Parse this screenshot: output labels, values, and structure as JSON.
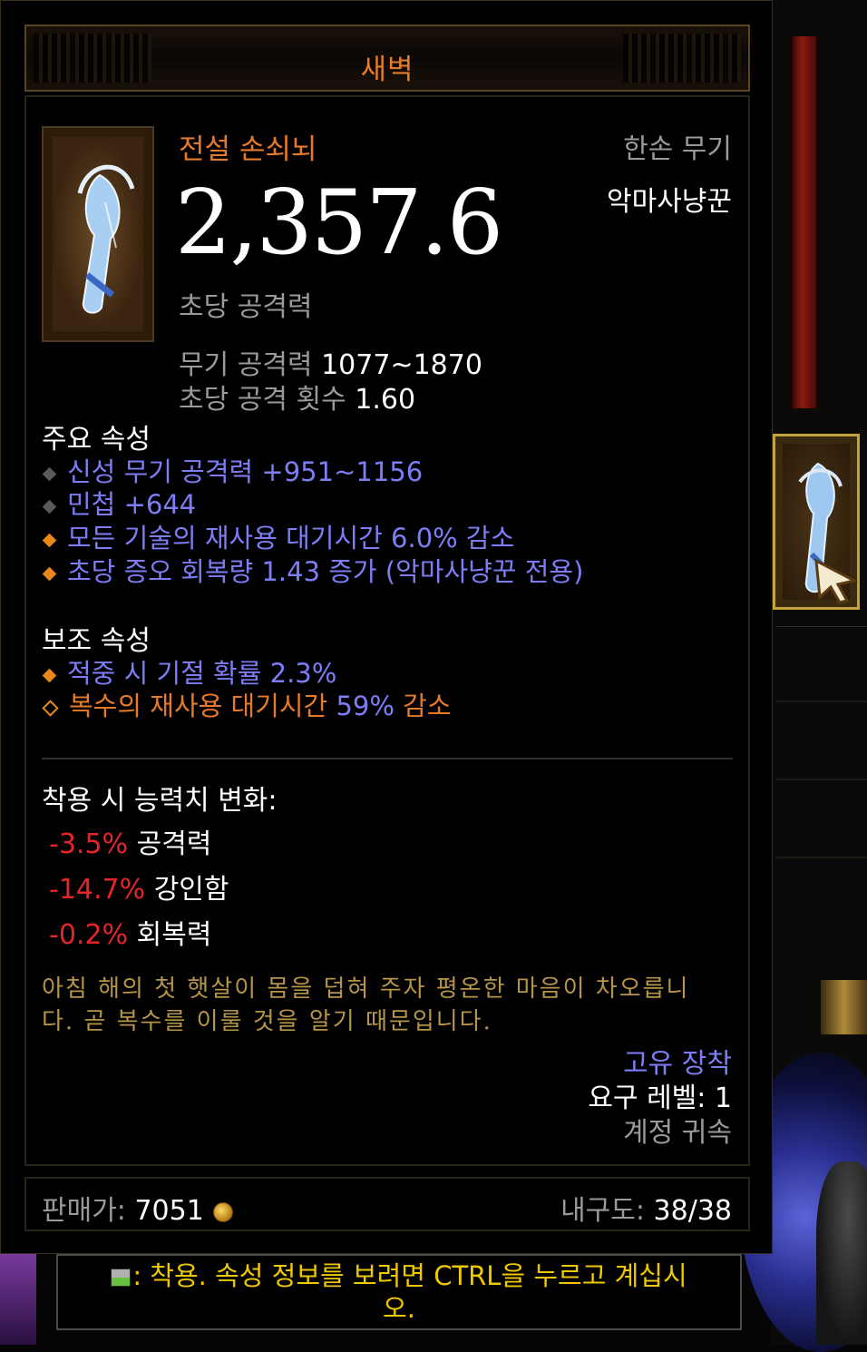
{
  "title": "새벽",
  "item": {
    "rarity_type": "전설 손쇠뇌",
    "slot": "한손 무기",
    "class_restriction": "악마사냥꾼",
    "dps": "2,357.6",
    "dps_label": "초당 공격력",
    "weapon_damage_label": "무기 공격력",
    "weapon_damage": "1077~1870",
    "attack_speed_label": "초당 공격 횟수",
    "attack_speed": "1.60"
  },
  "primary": {
    "header": "주요 속성",
    "stats": [
      "신성 무기 공격력 +951~1156",
      "민첩 +644",
      "모든 기술의 재사용 대기시간 6.0% 감소",
      "초당 증오 회복량 1.43 증가 (악마사냥꾼 전용)"
    ]
  },
  "secondary": {
    "header": "보조 속성",
    "stats": [
      "적중 시 기절 확률 2.3%",
      "복수의 재사용 대기시간"
    ],
    "legendary_value": "59%",
    "legendary_suffix": "감소"
  },
  "compare": {
    "header": "착용 시 능력치 변화:",
    "rows": [
      {
        "delta": "-3.5%",
        "stat": "공격력"
      },
      {
        "delta": "-14.7%",
        "stat": "강인함"
      },
      {
        "delta": "-0.2%",
        "stat": "회복력"
      }
    ]
  },
  "flavor": {
    "line1": "아침 해의 첫 햇살이 몸을 덥혀 주자 평온한 마음이 차오릅니",
    "line2": "다. 곧 복수를 이룰 것을 알기 때문입니다."
  },
  "meta": {
    "unique_equipped": "고유 장착",
    "required_level": "요구 레벨: 1",
    "account_bound": "계정 귀속"
  },
  "footer": {
    "sell_label": "판매가:",
    "sell_value": "7051",
    "durability_label": "내구도:",
    "durability_value": "38/38"
  },
  "hint": {
    "line1": ": 착용. 속성 정보를 보려면 CTRL을 누르고 계십시",
    "line2": "오."
  },
  "colors": {
    "legendary_orange": "#e57a2a",
    "magic_blue": "#7d7df5",
    "negative_red": "#e4252a",
    "flavor_gold": "#b69548",
    "hint_yellow": "#f0c800"
  },
  "icons": [
    "hand-crossbow-icon",
    "cursor-icon",
    "gold-coin-icon",
    "keyboard-icon",
    "diamond-bullet-icon"
  ]
}
